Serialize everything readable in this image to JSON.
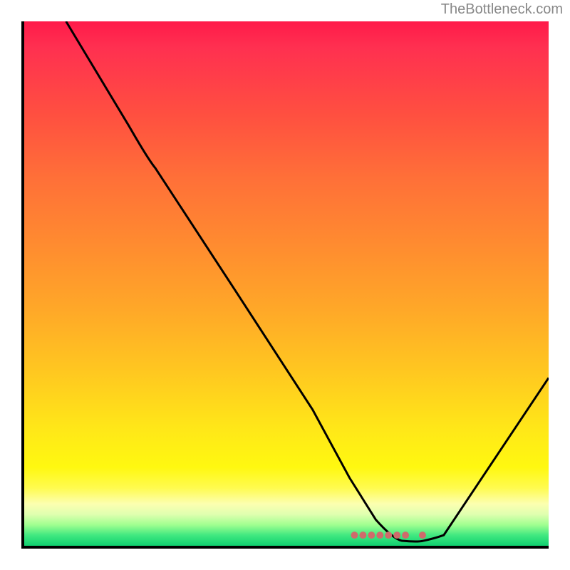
{
  "watermark": "TheBottleneck.com",
  "chart_data": {
    "type": "line",
    "title": "",
    "xlabel": "",
    "ylabel": "",
    "xlim": [
      0,
      100
    ],
    "ylim": [
      0,
      100
    ],
    "series": [
      {
        "name": "curve",
        "x": [
          8,
          20,
          25,
          40,
          55,
          62,
          67,
          72,
          76,
          80,
          100
        ],
        "y": [
          100,
          80,
          72,
          49,
          26,
          13,
          5,
          2,
          1,
          2,
          32
        ]
      }
    ],
    "marker": {
      "x_start": 63,
      "x_end": 76,
      "y": 2,
      "color": "#d67070"
    },
    "background": "vertical-gradient red-yellow-green"
  }
}
